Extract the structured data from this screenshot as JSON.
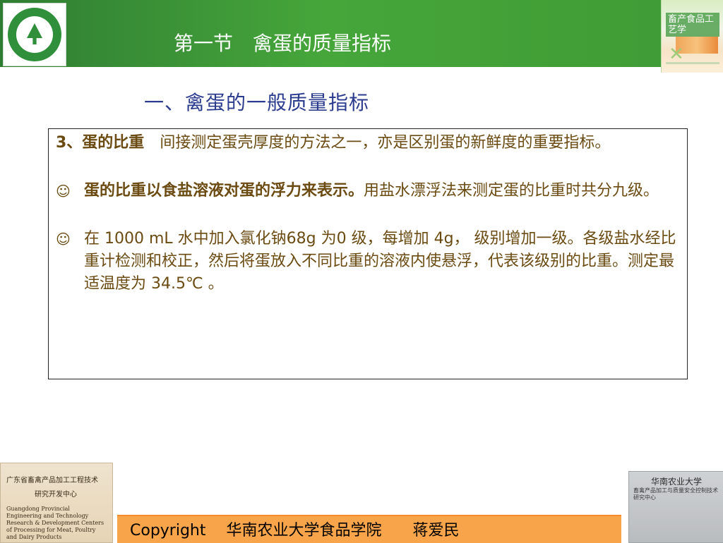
{
  "header": {
    "title": "第一节　禽蛋的质量指标"
  },
  "book": {
    "title": "畜产食品工艺学"
  },
  "subtitle": "一、禽蛋的一般质量指标",
  "content": {
    "p1_heading": "3、蛋的比重",
    "p1_text": "　间接测定蛋壳厚度的方法之一，亦是区别蛋的新鲜度的重要指标。",
    "p2_bold": "蛋的比重以食盐溶液对蛋的浮力来表示。",
    "p2_text": "用盐水漂浮法来测定蛋的比重时共分九级。",
    "p3_text": "在 1000 mL 水中加入氯化钠68g 为0 级，每增加 4g， 级别增加一级。各级盐水经比重计检测和校正，然后将蛋放入不同比重的溶液内使悬浮，代表该级别的比重。测定最适温度为 34.5℃ 。",
    "bullet_icon": "smile-icon"
  },
  "bottom_left": {
    "line1": "广东省畜禽产品加工工程技术",
    "line2": "研究开发中心",
    "line3": "Guangdong Provincial Engineering and Technology Research & Development Centers of Processing for Meat, Poultry and Dairy Products"
  },
  "bottom_right": {
    "line1": "华南农业大学",
    "line2": "畜禽产品加工与质量安全控制技术研究中心"
  },
  "footer": {
    "text": "Copyright　 华南农业大学食品学院　　蒋爱民"
  },
  "colors": {
    "header_green": "#3f9a35",
    "footer_orange": "#f7a44a",
    "text_brown": "#6b4b12",
    "subtitle_blue": "#2b3c8f"
  }
}
